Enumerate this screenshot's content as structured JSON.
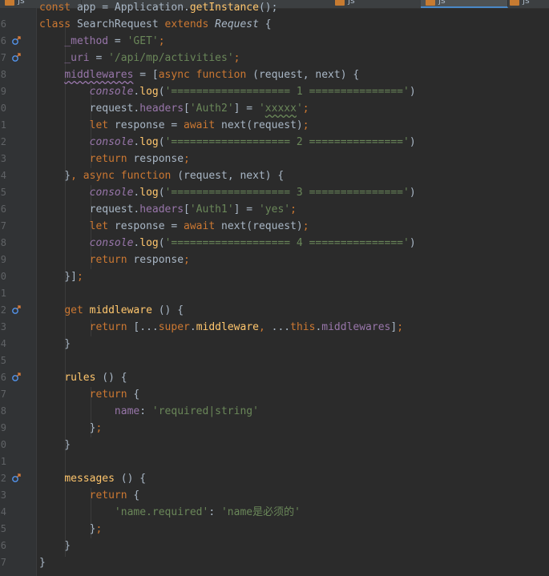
{
  "tabs": [
    {
      "label": "js"
    },
    {
      "label": "js"
    },
    {
      "label": "js"
    },
    {
      "label": "js"
    }
  ],
  "lines": [
    {
      "num": "",
      "tokens": [
        [
          "kw",
          "const"
        ],
        [
          "plain",
          " app = Application."
        ],
        [
          "fn",
          "getInstance"
        ],
        [
          "plain",
          "();"
        ]
      ]
    },
    {
      "num": "6",
      "tokens": [
        [
          "kw",
          "class"
        ],
        [
          "plain",
          " SearchRequest "
        ],
        [
          "kw",
          "extends"
        ],
        [
          "plain",
          " "
        ],
        [
          "cls-i",
          "Request"
        ],
        [
          "plain",
          " {"
        ]
      ]
    },
    {
      "num": "6",
      "marker": true,
      "tokens": [
        [
          "plain",
          "    "
        ],
        [
          "fld",
          "_method"
        ],
        [
          "plain",
          " = "
        ],
        [
          "str",
          "'GET'"
        ],
        [
          "kw",
          ";"
        ]
      ]
    },
    {
      "num": "7",
      "marker": true,
      "tokens": [
        [
          "plain",
          "    "
        ],
        [
          "fld",
          "_uri"
        ],
        [
          "plain",
          " = "
        ],
        [
          "str",
          "'/api/mp/activities'"
        ],
        [
          "kw",
          ";"
        ]
      ]
    },
    {
      "num": "8",
      "tokens": [
        [
          "plain",
          "    "
        ],
        [
          "fld wavy-f",
          "middlewares"
        ],
        [
          "plain",
          " = ["
        ],
        [
          "kw",
          "async function"
        ],
        [
          "plain",
          " (request, next) {"
        ]
      ]
    },
    {
      "num": "9",
      "tokens": [
        [
          "plain",
          "        "
        ],
        [
          "con",
          "console"
        ],
        [
          "plain",
          "."
        ],
        [
          "fn",
          "log"
        ],
        [
          "plain",
          "("
        ],
        [
          "str",
          "'=================== 1 ==============='"
        ],
        [
          "plain",
          ")"
        ]
      ]
    },
    {
      "num": "0",
      "tokens": [
        [
          "plain",
          "        request."
        ],
        [
          "fld",
          "headers"
        ],
        [
          "plain",
          "["
        ],
        [
          "str",
          "'Auth2'"
        ],
        [
          "plain",
          "] = "
        ],
        [
          "str",
          "'"
        ],
        [
          "str wavy",
          "xxxxx"
        ],
        [
          "str",
          "'"
        ],
        [
          "kw",
          ";"
        ]
      ]
    },
    {
      "num": "1",
      "tokens": [
        [
          "plain",
          "        "
        ],
        [
          "kw",
          "let"
        ],
        [
          "plain",
          " response = "
        ],
        [
          "kw",
          "await"
        ],
        [
          "plain",
          " next(request)"
        ],
        [
          "kw",
          ";"
        ]
      ]
    },
    {
      "num": "2",
      "tokens": [
        [
          "plain",
          "        "
        ],
        [
          "con",
          "console"
        ],
        [
          "plain",
          "."
        ],
        [
          "fn",
          "log"
        ],
        [
          "plain",
          "("
        ],
        [
          "str",
          "'=================== 2 ==============='"
        ],
        [
          "plain",
          ")"
        ]
      ]
    },
    {
      "num": "3",
      "tokens": [
        [
          "plain",
          "        "
        ],
        [
          "kw",
          "return"
        ],
        [
          "plain",
          " response"
        ],
        [
          "kw",
          ";"
        ]
      ]
    },
    {
      "num": "4",
      "tokens": [
        [
          "plain",
          "    }"
        ],
        [
          "kw",
          ","
        ],
        [
          "plain",
          " "
        ],
        [
          "kw",
          "async function"
        ],
        [
          "plain",
          " (request, next) {"
        ]
      ]
    },
    {
      "num": "5",
      "tokens": [
        [
          "plain",
          "        "
        ],
        [
          "con",
          "console"
        ],
        [
          "plain",
          "."
        ],
        [
          "fn",
          "log"
        ],
        [
          "plain",
          "("
        ],
        [
          "str",
          "'=================== 3 ==============='"
        ],
        [
          "plain",
          ")"
        ]
      ]
    },
    {
      "num": "6",
      "tokens": [
        [
          "plain",
          "        request."
        ],
        [
          "fld",
          "headers"
        ],
        [
          "plain",
          "["
        ],
        [
          "str",
          "'Auth1'"
        ],
        [
          "plain",
          "] = "
        ],
        [
          "str",
          "'yes'"
        ],
        [
          "kw",
          ";"
        ]
      ]
    },
    {
      "num": "7",
      "tokens": [
        [
          "plain",
          "        "
        ],
        [
          "kw",
          "let"
        ],
        [
          "plain",
          " response = "
        ],
        [
          "kw",
          "await"
        ],
        [
          "plain",
          " next(request)"
        ],
        [
          "kw",
          ";"
        ]
      ]
    },
    {
      "num": "8",
      "tokens": [
        [
          "plain",
          "        "
        ],
        [
          "con",
          "console"
        ],
        [
          "plain",
          "."
        ],
        [
          "fn",
          "log"
        ],
        [
          "plain",
          "("
        ],
        [
          "str",
          "'=================== 4 ==============='"
        ],
        [
          "plain",
          ")"
        ]
      ]
    },
    {
      "num": "9",
      "tokens": [
        [
          "plain",
          "        "
        ],
        [
          "kw",
          "return"
        ],
        [
          "plain",
          " response"
        ],
        [
          "kw",
          ";"
        ]
      ]
    },
    {
      "num": "0",
      "tokens": [
        [
          "plain",
          "    }]"
        ],
        [
          "kw",
          ";"
        ]
      ]
    },
    {
      "num": "1",
      "tokens": []
    },
    {
      "num": "2",
      "marker": true,
      "tokens": [
        [
          "plain",
          "    "
        ],
        [
          "kw",
          "get"
        ],
        [
          "plain",
          " "
        ],
        [
          "fn",
          "middleware"
        ],
        [
          "plain",
          " () {"
        ]
      ]
    },
    {
      "num": "3",
      "tokens": [
        [
          "plain",
          "        "
        ],
        [
          "kw",
          "return"
        ],
        [
          "plain",
          " [..."
        ],
        [
          "kw",
          "super"
        ],
        [
          "plain",
          "."
        ],
        [
          "fn",
          "middleware"
        ],
        [
          "kw",
          ","
        ],
        [
          "plain",
          " ..."
        ],
        [
          "kw",
          "this"
        ],
        [
          "plain",
          "."
        ],
        [
          "fld",
          "middlewares"
        ],
        [
          "plain",
          "]"
        ],
        [
          "kw",
          ";"
        ]
      ]
    },
    {
      "num": "4",
      "tokens": [
        [
          "plain",
          "    }"
        ]
      ]
    },
    {
      "num": "5",
      "tokens": []
    },
    {
      "num": "6",
      "marker": true,
      "tokens": [
        [
          "plain",
          "    "
        ],
        [
          "fn",
          "rules"
        ],
        [
          "plain",
          " () {"
        ]
      ]
    },
    {
      "num": "7",
      "tokens": [
        [
          "plain",
          "        "
        ],
        [
          "kw",
          "return"
        ],
        [
          "plain",
          " {"
        ]
      ]
    },
    {
      "num": "8",
      "tokens": [
        [
          "plain",
          "            "
        ],
        [
          "fld",
          "name"
        ],
        [
          "plain",
          ": "
        ],
        [
          "str",
          "'required|string'"
        ]
      ]
    },
    {
      "num": "9",
      "tokens": [
        [
          "plain",
          "        }"
        ],
        [
          "kw",
          ";"
        ]
      ]
    },
    {
      "num": "0",
      "tokens": [
        [
          "plain",
          "    }"
        ]
      ]
    },
    {
      "num": "1",
      "tokens": []
    },
    {
      "num": "2",
      "marker": true,
      "tokens": [
        [
          "plain",
          "    "
        ],
        [
          "fn",
          "messages"
        ],
        [
          "plain",
          " () {"
        ]
      ]
    },
    {
      "num": "3",
      "tokens": [
        [
          "plain",
          "        "
        ],
        [
          "kw",
          "return"
        ],
        [
          "plain",
          " {"
        ]
      ]
    },
    {
      "num": "4",
      "tokens": [
        [
          "plain",
          "            "
        ],
        [
          "str",
          "'name.required'"
        ],
        [
          "plain",
          ": "
        ],
        [
          "str",
          "'name是必须的'"
        ]
      ]
    },
    {
      "num": "5",
      "tokens": [
        [
          "plain",
          "        }"
        ],
        [
          "kw",
          ";"
        ]
      ]
    },
    {
      "num": "6",
      "tokens": [
        [
          "plain",
          "    }"
        ]
      ]
    },
    {
      "num": "7",
      "tokens": [
        [
          "plain",
          "}"
        ]
      ]
    }
  ],
  "colors": {
    "background": "#2b2b2b",
    "gutter": "#313335",
    "keyword": "#cc7832",
    "string": "#6a8759",
    "field": "#9876aa",
    "function": "#ffc66d",
    "text": "#a9b7c6"
  },
  "icons": {
    "gutter_marker": "override-arrow-icon"
  }
}
